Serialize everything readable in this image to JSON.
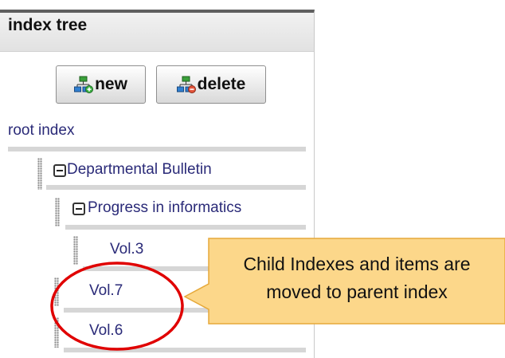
{
  "panel": {
    "title": "index tree"
  },
  "toolbar": {
    "new_label": "new",
    "delete_label": "delete"
  },
  "tree": {
    "root_label": "root index",
    "nodes": [
      {
        "label": "Departmental Bulletin",
        "expanded": true
      },
      {
        "label": "Progress in informatics",
        "expanded": true
      },
      {
        "label": "Vol.3"
      },
      {
        "label": "Vol.7"
      },
      {
        "label": "Vol.6"
      }
    ]
  },
  "callout": {
    "line1": "Child Indexes and items are",
    "line2": "moved to parent index"
  },
  "colors": {
    "link": "#2a2a78",
    "callout_fill": "#fcd78a",
    "highlight_ring": "#e00000"
  },
  "icons": [
    "add-index-icon",
    "delete-index-icon",
    "collapse-icon",
    "drag-handle-icon"
  ]
}
